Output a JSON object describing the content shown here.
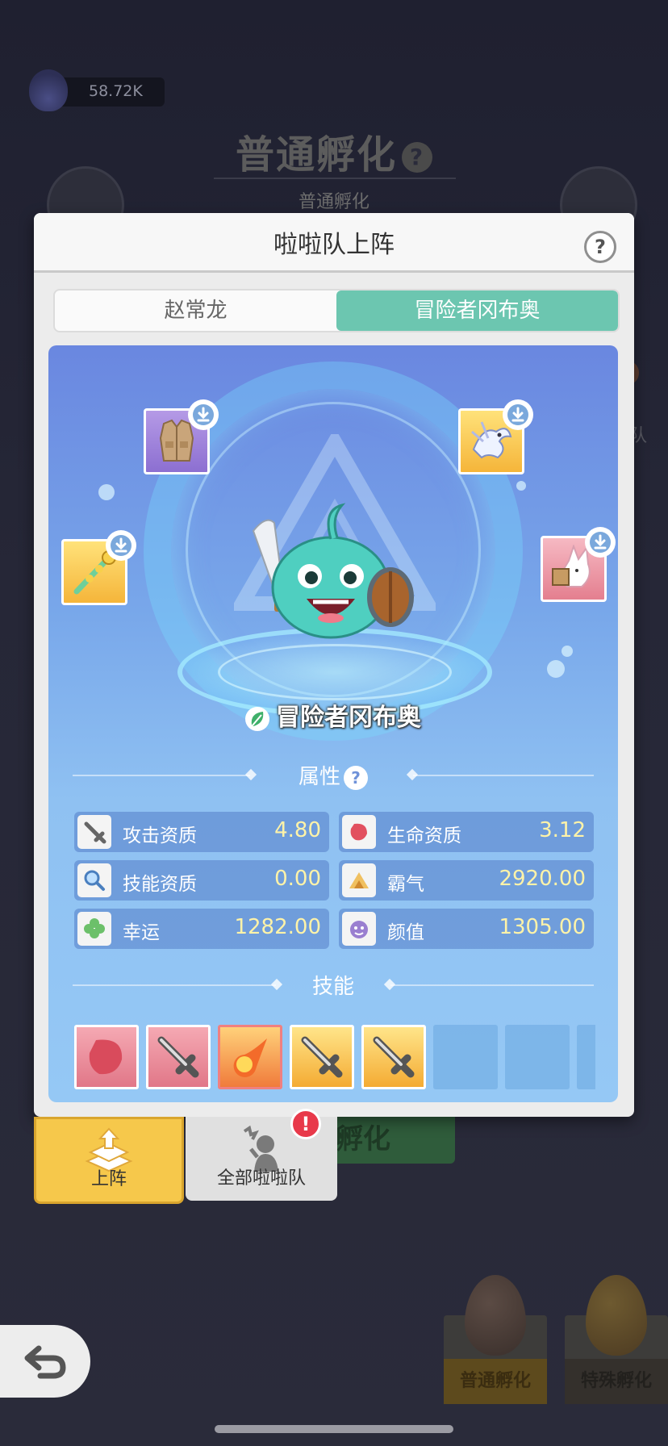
{
  "background": {
    "currency_value": "58.72K",
    "title": "普通孵化",
    "title_help": "?",
    "subtitle": "普通孵化",
    "side_text": "队",
    "green_button_text": "孵化",
    "egg_cards": [
      {
        "label": "普通孵化"
      },
      {
        "label": "特殊孵化"
      }
    ]
  },
  "modal": {
    "title": "啦啦队上阵",
    "help": "?",
    "tabs": [
      {
        "label": "赵常龙",
        "active": false
      },
      {
        "label": "冒险者冈布奥",
        "active": true
      }
    ],
    "equipment_slots": [
      {
        "icon": "vest-icon",
        "color": "purple"
      },
      {
        "icon": "dragon-icon",
        "color": "gold"
      },
      {
        "icon": "staff-icon",
        "color": "gold"
      },
      {
        "icon": "fox-icon",
        "color": "pink"
      }
    ],
    "pet_name": "冒险者冈布奥",
    "attributes_title": "属性",
    "attributes_help": "?",
    "attributes": [
      {
        "label": "攻击资质",
        "value": "4.80",
        "icon": "sword-icon"
      },
      {
        "label": "生命资质",
        "value": "3.12",
        "icon": "heart-icon"
      },
      {
        "label": "技能资质",
        "value": "0.00",
        "icon": "magnifier-icon"
      },
      {
        "label": "霸气",
        "value": "2920.00",
        "icon": "mountain-icon"
      },
      {
        "label": "幸运",
        "value": "1282.00",
        "icon": "clover-icon"
      },
      {
        "label": "颜值",
        "value": "1305.00",
        "icon": "face-icon"
      }
    ],
    "skills_title": "技能",
    "skills": [
      {
        "icon": "heart-icon",
        "style": "pink"
      },
      {
        "icon": "sword-icon",
        "style": "pink"
      },
      {
        "icon": "fireball-icon",
        "style": "fire"
      },
      {
        "icon": "sword-icon",
        "style": "gold"
      },
      {
        "icon": "sword-icon",
        "style": "gold"
      },
      {
        "icon": "",
        "style": "empty"
      },
      {
        "icon": "",
        "style": "empty"
      },
      {
        "icon": "",
        "style": "empty"
      }
    ]
  },
  "bottom_tabs": [
    {
      "label": "上阵",
      "active": true,
      "icon": "deploy-icon"
    },
    {
      "label": "全部啦啦队",
      "active": false,
      "icon": "cheer-squad-icon",
      "alert": "!"
    }
  ],
  "colors": {
    "tab_active": "#6cc6b0",
    "stage_top": "#6a87e0",
    "value_text": "#fff3a8",
    "bottom_tab_active": "#f6c84b",
    "alert": "#e8394a"
  }
}
